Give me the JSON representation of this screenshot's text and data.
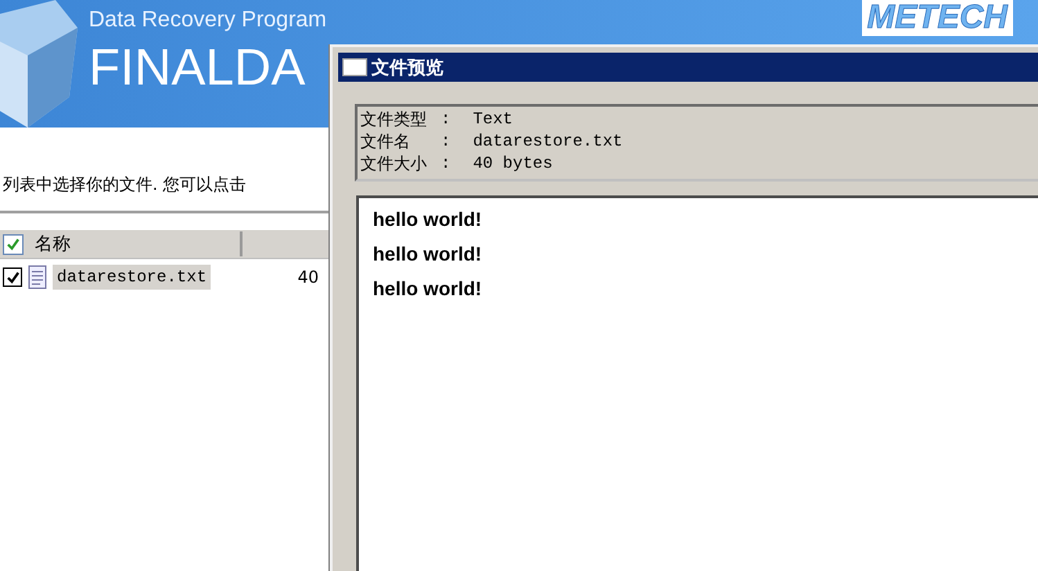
{
  "app": {
    "subtitle": "Data Recovery Program",
    "title": "FINALDA",
    "logo": "METECH",
    "instruction": "列表中选择你的文件.  您可以点击",
    "list": {
      "header_checked": true,
      "columns": [
        "名称"
      ],
      "rows": [
        {
          "name": "datarestore.txt",
          "size": "40",
          "checked": true,
          "selected": true
        }
      ]
    }
  },
  "preview_window": {
    "title": "文件预览",
    "info": [
      {
        "label": "文件类型",
        "separator": ":",
        "value": "Text"
      },
      {
        "label": "文件名",
        "separator": ":",
        "value": "datarestore.txt"
      },
      {
        "label": "文件大小",
        "separator": ":",
        "value": "40 bytes"
      }
    ],
    "content": [
      "hello world!",
      "hello world!",
      "hello world!"
    ]
  }
}
